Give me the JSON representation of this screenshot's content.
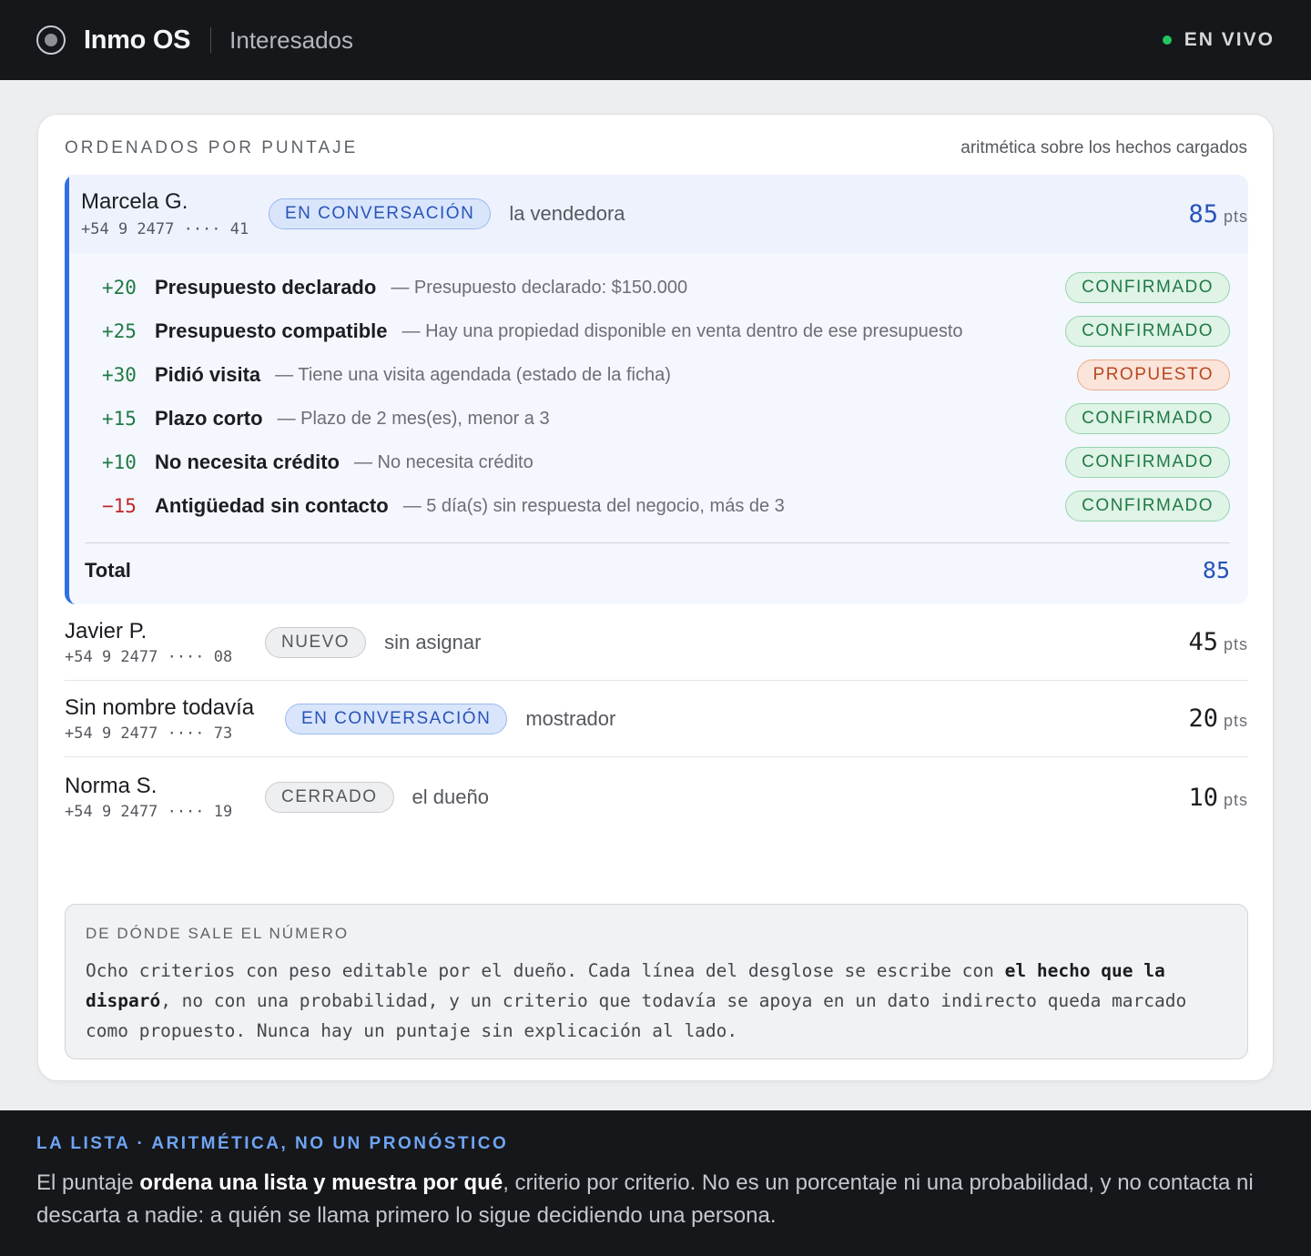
{
  "header": {
    "app_name": "Inmo OS",
    "section": "Interesados",
    "live_label": "EN VIVO"
  },
  "card": {
    "kicker": "ORDENADOS POR PUNTAJE",
    "note": "aritmética sobre los hechos cargados"
  },
  "leads": [
    {
      "name": "Marcela G.",
      "phone": "+54 9 2477 ···· 41",
      "status": "EN CONVERSACIÓN",
      "owner": "la vendedora",
      "score": "85",
      "pts_label": "pts",
      "criteria": [
        {
          "points": "+20",
          "name": "Presupuesto declarado",
          "note": "— Presupuesto declarado: $150.000",
          "state": "CONFIRMADO"
        },
        {
          "points": "+25",
          "name": "Presupuesto compatible",
          "note": "— Hay una propiedad disponible en venta dentro de ese presupuesto",
          "state": "CONFIRMADO"
        },
        {
          "points": "+30",
          "name": "Pidió visita",
          "note": "— Tiene una visita agendada (estado de la ficha)",
          "state": "PROPUESTO"
        },
        {
          "points": "+15",
          "name": "Plazo corto",
          "note": "— Plazo de 2 mes(es), menor a 3",
          "state": "CONFIRMADO"
        },
        {
          "points": "+10",
          "name": "No necesita crédito",
          "note": "— No necesita crédito",
          "state": "CONFIRMADO"
        },
        {
          "points": "−15",
          "name": "Antigüedad sin contacto",
          "note": "— 5 día(s) sin respuesta del negocio, más de 3",
          "state": "CONFIRMADO"
        }
      ],
      "total_label": "Total",
      "total": "85"
    },
    {
      "name": "Javier P.",
      "phone": "+54 9 2477 ···· 08",
      "status": "NUEVO",
      "owner": "sin asignar",
      "score": "45",
      "pts_label": "pts"
    },
    {
      "name": "Sin nombre todavía",
      "phone": "+54 9 2477 ···· 73",
      "status": "EN CONVERSACIÓN",
      "owner": "mostrador",
      "score": "20",
      "pts_label": "pts"
    },
    {
      "name": "Norma S.",
      "phone": "+54 9 2477 ···· 19",
      "status": "CERRADO",
      "owner": "el dueño",
      "score": "10",
      "pts_label": "pts"
    }
  ],
  "explain": {
    "title": "DE DÓNDE SALE EL NÚMERO",
    "text_before": "Ocho criterios con peso editable por el dueño. Cada línea del desglose se escribe con ",
    "text_bold": "el hecho que la disparó",
    "text_after": ", no con una probabilidad, y un criterio que todavía se apoya en un dato indirecto queda marcado como propuesto. Nunca hay un puntaje sin explicación al lado."
  },
  "footer": {
    "kicker": "LA LISTA · ARITMÉTICA, NO UN PRONÓSTICO",
    "text_before": "El puntaje ",
    "text_bold": "ordena una lista y muestra por qué",
    "text_after": ", criterio por criterio. No es un porcentaje ni una probabilidad, y no contacta ni descarta a nadie: a quién se llama primero lo sigue decidiendo una persona."
  },
  "colors": {
    "accent": "#2f6fe4",
    "positive": "#1f7a45",
    "negative": "#c0262b",
    "live": "#22c55e"
  }
}
